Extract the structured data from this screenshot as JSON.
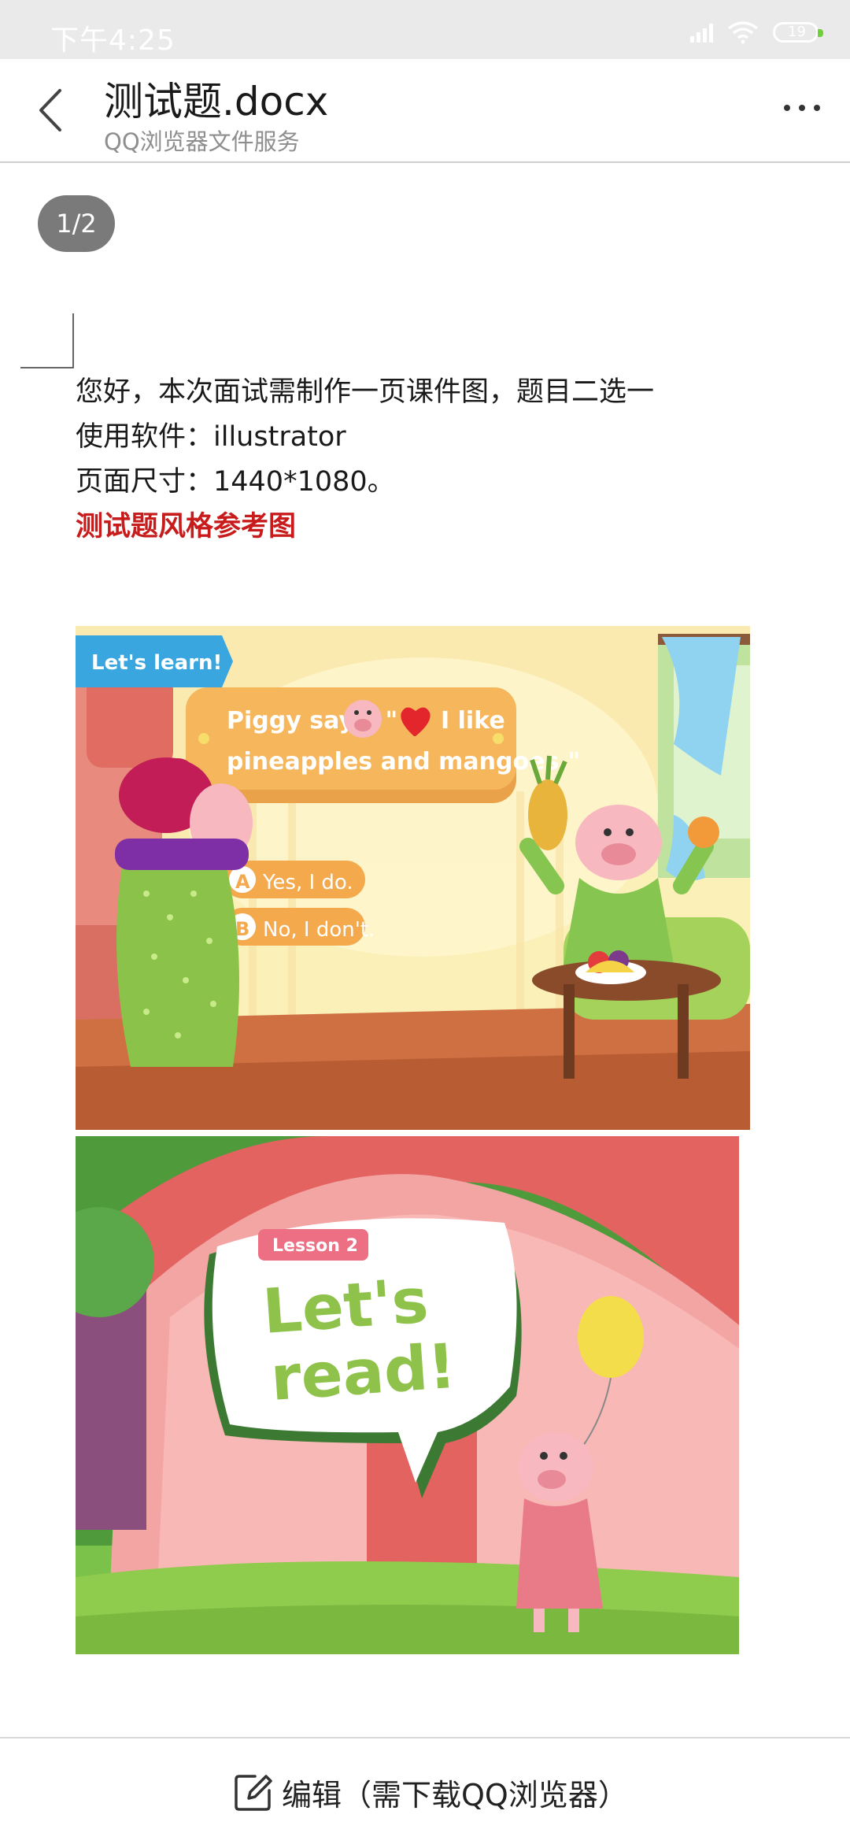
{
  "status_bar": {
    "time": "下午4:25",
    "battery": "19"
  },
  "header": {
    "title": "测试题.docx",
    "subtitle": "QQ浏览器文件服务"
  },
  "page_indicator": "1/2",
  "document": {
    "lines": [
      "您好，本次面试需制作一页课件图，题目二选一",
      "使用软件：illustrator",
      "页面尺寸：1440*1080。"
    ],
    "highlight": "测试题风格参考图"
  },
  "image1": {
    "tag": "Let's learn!",
    "speech_line1_a": "Piggy says, \"",
    "speech_line1_b": "I like",
    "speech_line2": "pineapples and mangoes.\"",
    "option_a_letter": "A",
    "option_a": "Yes, I do.",
    "option_b_letter": "B",
    "option_b": "No, I don't."
  },
  "image2": {
    "lesson": "Lesson 2",
    "headline_1": "Let's",
    "headline_2": "read!"
  },
  "bottom_bar": {
    "edit_label": "编辑（需下载QQ浏览器）"
  },
  "colors": {
    "highlight_red": "#c81c1c",
    "badge_gray": "#7a7a7a",
    "battery_green": "#6fd13a"
  },
  "icons": [
    "back-icon",
    "more-icon",
    "wifi-icon",
    "signal-icon",
    "battery-icon",
    "edit-icon"
  ]
}
